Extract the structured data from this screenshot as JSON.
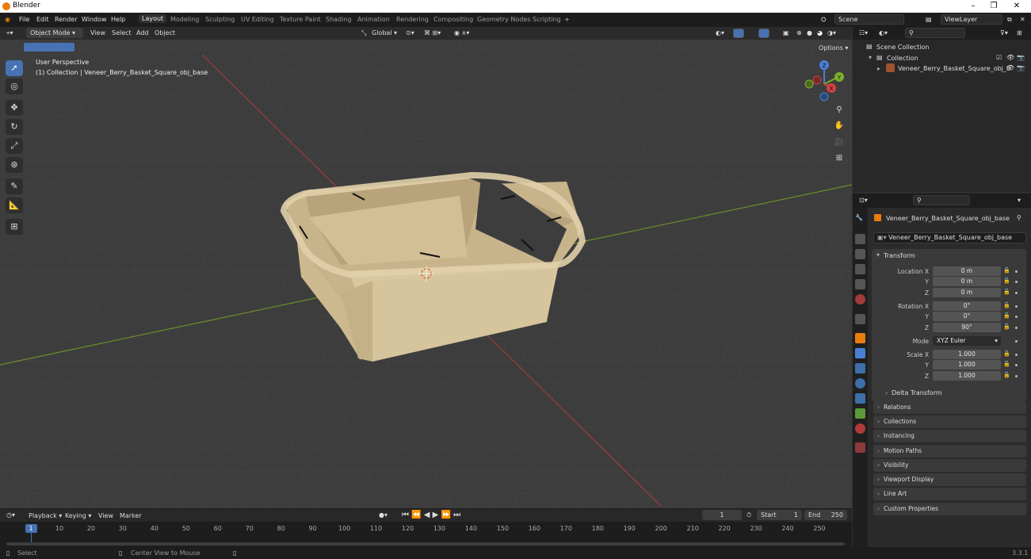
{
  "os_title": "Blender",
  "menus": [
    "File",
    "Edit",
    "Render",
    "Window",
    "Help"
  ],
  "workspaces": [
    "Layout",
    "Modeling",
    "Sculpting",
    "UV Editing",
    "Texture Paint",
    "Shading",
    "Animation",
    "Rendering",
    "Compositing",
    "Geometry Nodes",
    "Scripting"
  ],
  "add_workspace": "+",
  "scene": "Scene",
  "view_layer": "ViewLayer",
  "viewport": {
    "mode": "Object Mode",
    "menus": [
      "View",
      "Select",
      "Add",
      "Object"
    ],
    "orientation": "Global",
    "options": "Options",
    "perspective": "User Perspective",
    "collection_label": "(1) Collection | Veneer_Berry_Basket_Square_obj_base",
    "axis_labels": {
      "z": "Z",
      "y": "Y",
      "x": "X"
    }
  },
  "outliner": {
    "scene_collection": "Scene Collection",
    "collection": "Collection",
    "object": "Veneer_Berry_Basket_Square_obj_b"
  },
  "properties": {
    "object_name": "Veneer_Berry_Basket_Square_obj_base",
    "object_field": "Veneer_Berry_Basket_Square_obj_base",
    "transform_title": "Transform",
    "location_label": "Location X",
    "location": [
      "0 m",
      "0 m",
      "0 m"
    ],
    "rotation_label": "Rotation X",
    "rotation": [
      "0°",
      "0°",
      "90°"
    ],
    "mode_label": "Mode",
    "mode_value": "XYZ Euler",
    "scale_label": "Scale X",
    "scale": [
      "1.000",
      "1.000",
      "1.000"
    ],
    "axis_y": "Y",
    "axis_z": "Z",
    "delta_transform": "Delta Transform",
    "panels": [
      "Relations",
      "Collections",
      "Instancing",
      "Motion Paths",
      "Visibility",
      "Viewport Display",
      "Line Art",
      "Custom Properties"
    ]
  },
  "timeline": {
    "menus": [
      "Playback",
      "Keying",
      "View",
      "Marker"
    ],
    "current_frame": "1",
    "start_label": "Start",
    "start": "1",
    "end_label": "End",
    "end": "250",
    "ticks": [
      "1",
      "10",
      "20",
      "30",
      "40",
      "50",
      "60",
      "70",
      "80",
      "90",
      "100",
      "110",
      "120",
      "130",
      "140",
      "150",
      "160",
      "170",
      "180",
      "190",
      "200",
      "210",
      "220",
      "230",
      "240",
      "250"
    ]
  },
  "status": {
    "select": "Select",
    "center_view": "Center View to Mouse",
    "version": "3.3.1"
  },
  "colors": {
    "accent": "#4772b3",
    "basket": "#d8c6a0",
    "grid_red": "#a33a3a",
    "grid_green": "#6b8f2a"
  }
}
